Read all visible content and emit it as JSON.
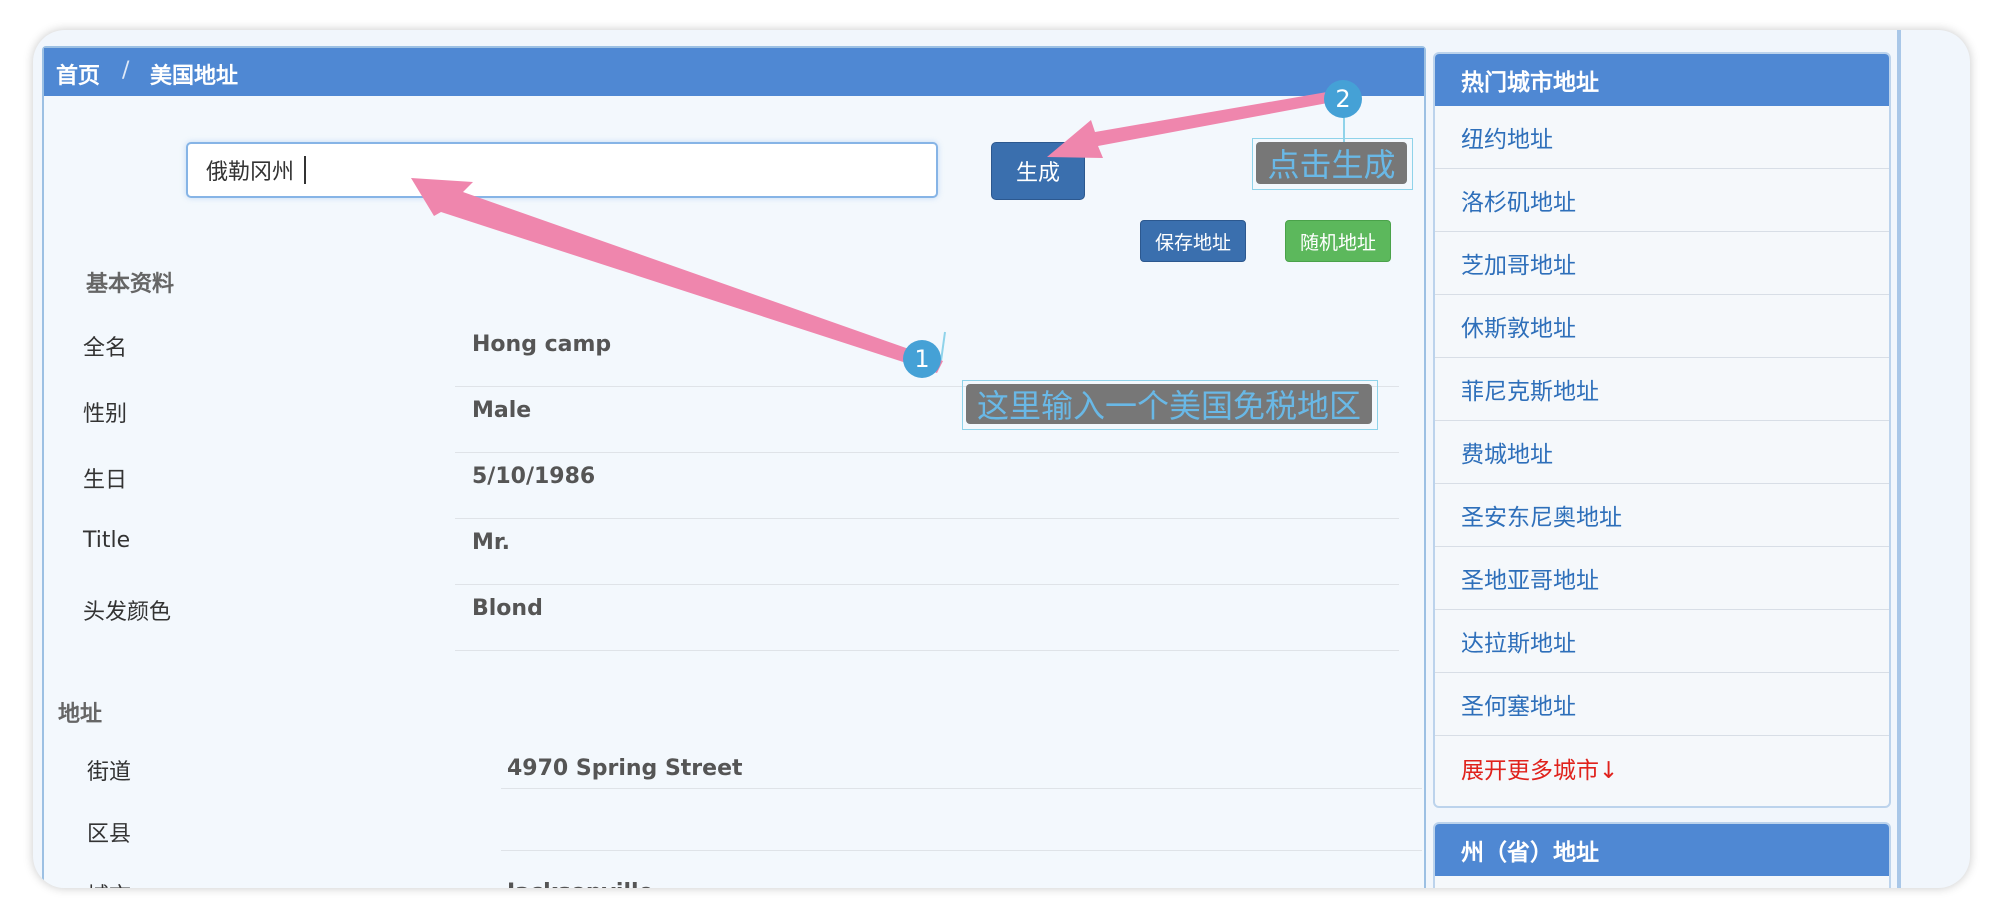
{
  "breadcrumb": {
    "home": "首页",
    "separator": "/",
    "current": "美国地址"
  },
  "search": {
    "value": "俄勒冈州"
  },
  "buttons": {
    "generate": "生成",
    "save": "保存地址",
    "random": "随机地址"
  },
  "basic": {
    "title": "基本资料",
    "rows": [
      {
        "label": "全名",
        "value": "Hong camp"
      },
      {
        "label": "性别",
        "value": "Male"
      },
      {
        "label": "生日",
        "value": "5/10/1986"
      },
      {
        "label": "Title",
        "value": "Mr."
      },
      {
        "label": "头发颜色",
        "value": "Blond"
      }
    ]
  },
  "address": {
    "title": "地址",
    "rows": [
      {
        "label": "街道",
        "value": "4970  Spring Street"
      },
      {
        "label": "区县",
        "value": ""
      },
      {
        "label": "城市",
        "value": "Jacksonville"
      }
    ]
  },
  "sidebar": {
    "title": "热门城市地址",
    "items": [
      {
        "label": "纽约地址"
      },
      {
        "label": "洛杉矶地址"
      },
      {
        "label": "芝加哥地址"
      },
      {
        "label": "休斯敦地址"
      },
      {
        "label": "菲尼克斯地址"
      },
      {
        "label": "费城地址"
      },
      {
        "label": "圣安东尼奥地址"
      },
      {
        "label": "圣地亚哥地址"
      },
      {
        "label": "达拉斯地址"
      },
      {
        "label": "圣何塞地址"
      }
    ],
    "more": "展开更多城市↓",
    "state_title": "州（省）地址"
  },
  "annotations": {
    "one": {
      "number": "1",
      "text": "这里输入一个美国免税地区"
    },
    "two": {
      "number": "2",
      "text": "点击生成"
    }
  },
  "colors": {
    "header_blue": "#4f88d3",
    "primary_button": "#3a6fae",
    "success_button": "#5cb85c",
    "link": "#2e6fba",
    "more_link": "#e0221c",
    "arrow_pink": "#ef86ad",
    "badge_blue": "#45a1d6"
  }
}
